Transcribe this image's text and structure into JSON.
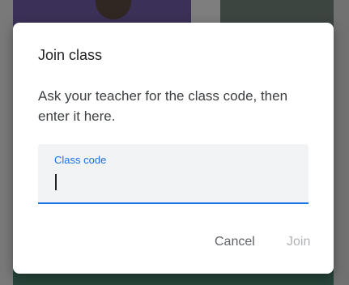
{
  "dialog": {
    "title": "Join class",
    "message": "Ask your teacher for the class code, then enter it here.",
    "field": {
      "label": "Class code",
      "value": ""
    },
    "actions": {
      "cancel_label": "Cancel",
      "join_label": "Join",
      "join_enabled": false
    }
  },
  "colors": {
    "accent": "#1a73e8",
    "field_background": "#f1f3f4",
    "disabled_text": "#b0b3b8"
  }
}
